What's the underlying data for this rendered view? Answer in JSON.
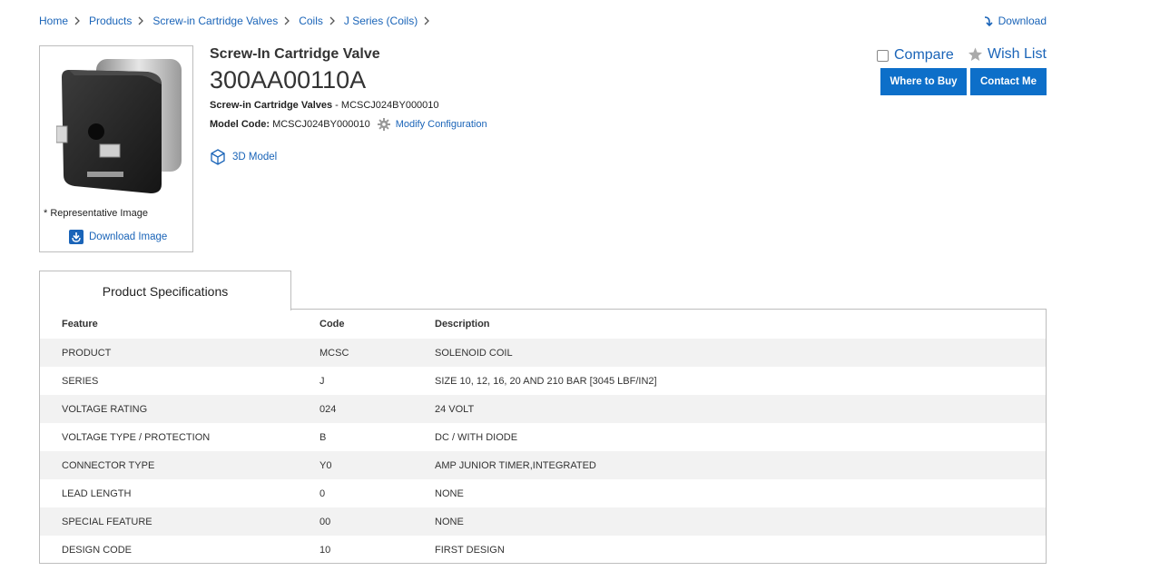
{
  "breadcrumb": [
    "Home",
    "Products",
    "Screw-in Cartridge Valves",
    "Coils",
    "J Series (Coils)"
  ],
  "download_label": "Download",
  "image_card": {
    "note": "* Representative Image",
    "download_label": "Download Image"
  },
  "product": {
    "subtitle": "Screw-In Cartridge Valve",
    "part_number": "300AA00110A",
    "category_label": "Screw-in Cartridge Valves",
    "category_sep": " - ",
    "category_code": "MCSCJ024BY000010",
    "model_code_label": "Model Code:",
    "model_code": "MCSCJ024BY000010",
    "modify_label": "Modify Configuration",
    "model3d_label": "3D Model"
  },
  "actions": {
    "compare_label": "Compare",
    "wishlist_label": "Wish List",
    "where_to_buy": "Where to Buy",
    "contact_me": "Contact Me"
  },
  "specs": {
    "tab_label": "Product Specifications",
    "headers": [
      "Feature",
      "Code",
      "Description"
    ],
    "rows": [
      [
        "PRODUCT",
        "MCSC",
        "SOLENOID COIL"
      ],
      [
        "SERIES",
        "J",
        "SIZE 10, 12, 16, 20 AND 210 BAR [3045 LBF/IN2]"
      ],
      [
        "VOLTAGE RATING",
        "024",
        "24 VOLT"
      ],
      [
        "VOLTAGE TYPE / PROTECTION",
        "B",
        "DC / WITH DIODE"
      ],
      [
        "CONNECTOR TYPE",
        "Y0",
        "AMP JUNIOR TIMER,INTEGRATED"
      ],
      [
        "LEAD LENGTH",
        "0",
        "NONE"
      ],
      [
        "SPECIAL FEATURE",
        "00",
        "NONE"
      ],
      [
        "DESIGN CODE",
        "10",
        "FIRST DESIGN"
      ]
    ]
  },
  "colors": {
    "link": "#1a64b8",
    "button": "#0d6fc9",
    "row_stripe": "#f2f2f2",
    "border": "#bdbdbd"
  }
}
